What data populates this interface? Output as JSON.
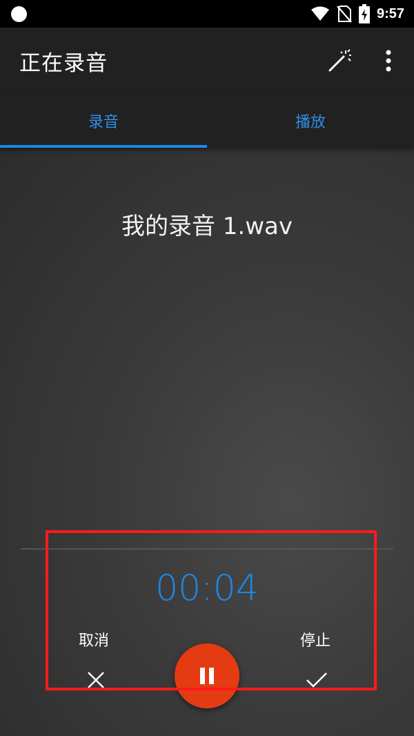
{
  "status_bar": {
    "time": "9:57",
    "icons": [
      "circle-icon",
      "wifi-icon",
      "no-sim-icon",
      "battery-charging-icon"
    ]
  },
  "app_bar": {
    "title": "正在录音",
    "actions": [
      "magic-wand-icon",
      "more-vert-icon"
    ]
  },
  "tabs": [
    {
      "label": "录音",
      "selected": true
    },
    {
      "label": "播放",
      "selected": false
    }
  ],
  "recording": {
    "file_name": "我的录音 1.wav",
    "elapsed": "00:04"
  },
  "controls": {
    "cancel_label": "取消",
    "stop_label": "停止",
    "cancel_icon": "close-icon",
    "pause_icon": "pause-icon",
    "stop_icon": "check-icon"
  },
  "colors": {
    "accent": "#1e88e5",
    "record_button": "#e53b12",
    "highlight": "#ff1a1a",
    "app_bar": "#212121"
  }
}
